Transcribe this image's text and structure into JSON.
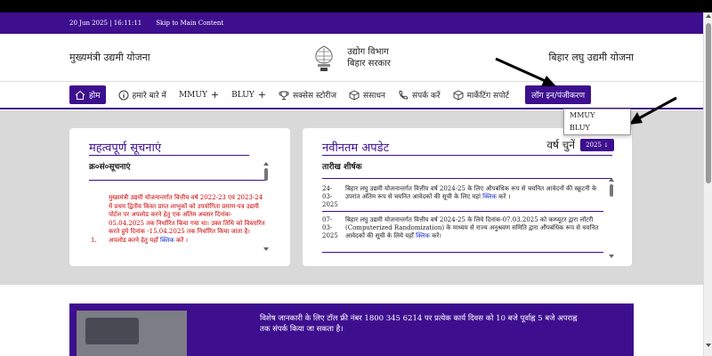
{
  "infobar": {
    "datetime": "20 Jun 2025 | 16:11:11",
    "skip_link": "Skip to Main Content"
  },
  "header": {
    "left_title": "मुख्यमंत्री उद्यमी योजना",
    "dept_line1": "उद्योग विभाग",
    "dept_line2": "बिहार सरकार",
    "right_title": "बिहार लघु उद्यमी योजना"
  },
  "nav": {
    "home": "होम",
    "about": "हमारे बारे में",
    "mmuy": "MMUY",
    "bluy": "BLUY",
    "success": "सक्सेस स्टोरीज",
    "resources": "संसाधन",
    "contact": "संपर्क करें",
    "marketing": "मार्केटिंग सपोर्ट",
    "login": "लॉग इन/पंजीकरण",
    "plus": "+"
  },
  "dropdown": {
    "items": [
      "MMUY",
      "BLUY"
    ]
  },
  "notices": {
    "title": "महत्वपूर्ण सूचनाएं",
    "header": "क्र०सं०सूचनाएं",
    "item_number": "1.",
    "item_text": "मुख्यमंत्री उद्यमी योजनान्तर्गत वित्तीय वर्ष 2022-23 एवं 2023-24 में प्रथम द्वितीय किस्त प्राप्त लाभुकों को उपयोगिता प्रमाण-पत्र उद्यमी पोर्टल पर अपलोड करने हेतु एक अंतिम अवसर दिनांक- 05.04.2025 तक निर्धारित किया गया था। उक्त तिथि को विस्तारित करते हुये दिनांक -15.04.2025 तक निर्धारित किया जाता है। अपलोड करने हेतु यहाँ",
    "item_link": "क्लिक",
    "item_suffix": "करें ।"
  },
  "updates": {
    "title": "नवीनतम अपडेट",
    "year_label": "वर्ष चुनें",
    "year_value": "2025",
    "header": "तारीख शीर्षक",
    "rows": [
      {
        "date": "24-03-2025",
        "text": "बिहार लघु उद्यमी योजनान्तर्गत वित्तीय वर्ष 2024-25 के लिए औपबंधिक रूप से चयनित आवेदनों की स्क्रूटनी के उपरांत अंतिम रूप से चयनित आवेदकों की सूची के लिए यहां",
        "link": "क्लिक",
        "suffix": "करें ।"
      },
      {
        "date": "07-03-2025",
        "text": "बिहार लघु उद्यमी योजनान्तर्गत वित्तीय वर्ष 2024-25 के लिये दिनांक-07.03.2025 को कम्प्यूटर द्वारा लॉटरी (Computerized Randomization) के माध्यम से राज्य अनुश्रवण समिति द्वारा औपबंधिक रूप से चयनित आवेदकों की सूची के लिये यहाँ",
        "link": "क्लिक",
        "suffix": "करें।"
      }
    ]
  },
  "banner": {
    "text": "विशेष जानकारी के लिए टॉल फ्री नंबर 1800 345 6214 पर प्रत्येक कार्य दिवस को 10 बजे पूर्वाह्न 5 बजे अपराह्न तक संपर्क किया जा सकता है।"
  },
  "colors": {
    "primary": "#3d0f8f",
    "notice_red": "#cc0000",
    "link_blue": "#1a32c8",
    "grey_bg": "#d9d9d9"
  }
}
